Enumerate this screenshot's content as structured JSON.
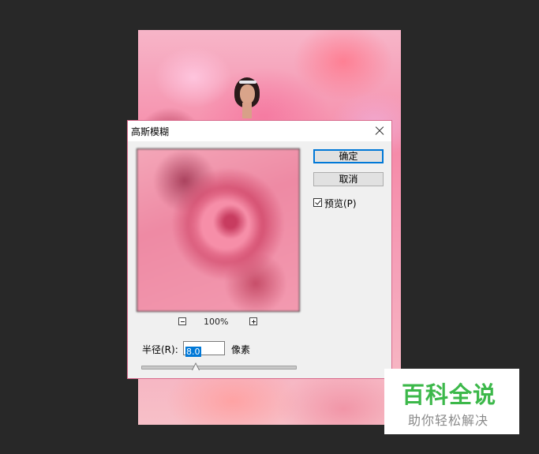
{
  "dialog": {
    "title": "高斯模糊",
    "ok_label": "确定",
    "cancel_label": "取消",
    "preview_checkbox": {
      "label": "预览(P)",
      "checked": true
    },
    "zoom_level": "100%",
    "radius": {
      "label": "半径(R):",
      "value": "8.0",
      "unit": "像素"
    },
    "slider_position": 0.35
  },
  "watermark": {
    "title": "百科全说",
    "subtitle": "助你轻松解决"
  },
  "colors": {
    "app_background": "#282828",
    "dialog_border": "#d86a8c",
    "default_button_border": "#0078d7",
    "watermark_green": "#3cb84a"
  }
}
